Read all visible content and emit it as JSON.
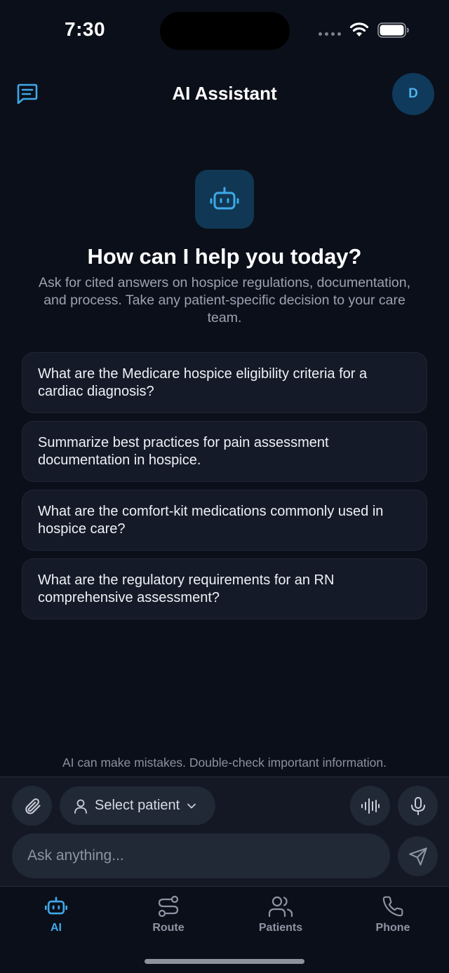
{
  "status_bar": {
    "time": "7:30"
  },
  "header": {
    "title": "AI Assistant",
    "avatar_initial": "D"
  },
  "hero": {
    "title": "How can I help you today?",
    "subtitle": "Ask for cited answers on hospice regulations, documentation, and process. Take any patient-specific decision to your care team."
  },
  "suggestions": [
    "What are the Medicare hospice eligibility criteria for a cardiac diagnosis?",
    "Summarize best practices for pain assessment documentation in hospice.",
    "What are the comfort-kit medications commonly used in hospice care?",
    "What are the regulatory requirements for an RN comprehensive assessment?"
  ],
  "disclaimer": "AI can make mistakes. Double-check important information.",
  "composer": {
    "patient_select_label": "Select patient",
    "input_placeholder": "Ask anything..."
  },
  "tabs": [
    {
      "label": "AI",
      "icon": "bot-icon",
      "active": true
    },
    {
      "label": "Route",
      "icon": "route-icon",
      "active": false
    },
    {
      "label": "Patients",
      "icon": "users-icon",
      "active": false
    },
    {
      "label": "Phone",
      "icon": "phone-icon",
      "active": false
    }
  ],
  "colors": {
    "background": "#0b0f19",
    "accent": "#3ea9e8",
    "card": "#141a27",
    "control": "#212836"
  }
}
